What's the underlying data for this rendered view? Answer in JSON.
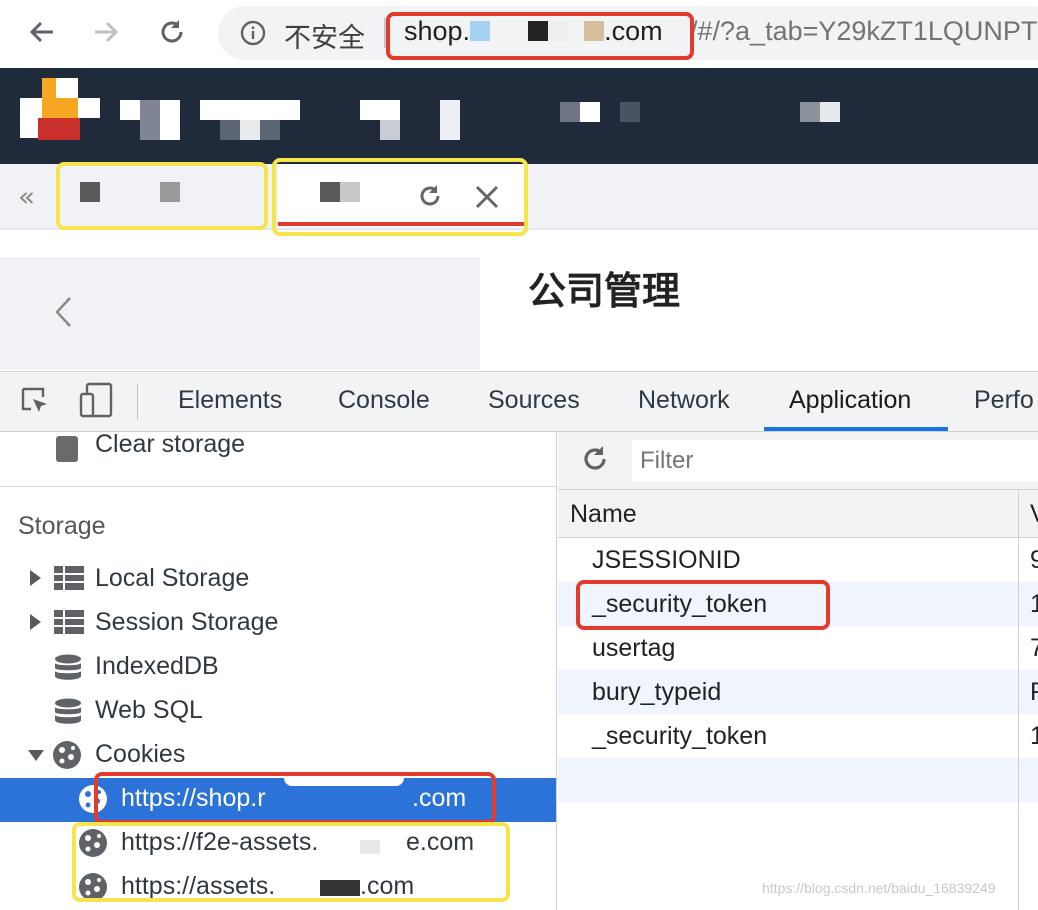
{
  "browser": {
    "insecure_label": "不安全",
    "host_prefix": "shop.",
    "host_suffix": ".com",
    "path": "/#/?a_tab=Y29kZT1LQUNPT"
  },
  "page": {
    "title": "公司管理"
  },
  "devtools": {
    "tabs": [
      "Elements",
      "Console",
      "Sources",
      "Network",
      "Application",
      "Perfo"
    ],
    "active_tab": "Application"
  },
  "sidebar": {
    "clear_storage": "Clear storage",
    "storage_heading": "Storage",
    "items": [
      "Local Storage",
      "Session Storage",
      "IndexedDB",
      "Web SQL",
      "Cookies"
    ],
    "cookie_origins": [
      "https://shop.r",
      "https://f2e-assets.",
      "https://assets."
    ],
    "cookie_origin_suffixes": [
      ".com",
      "e.com",
      ".com"
    ]
  },
  "cookies": {
    "filter_placeholder": "Filter",
    "columns": [
      "Name",
      "V"
    ],
    "rows": [
      {
        "name": "JSESSIONID",
        "value": "9"
      },
      {
        "name": "_security_token",
        "value": "1"
      },
      {
        "name": "usertag",
        "value": "7"
      },
      {
        "name": "bury_typeid",
        "value": "F"
      },
      {
        "name": "_security_token",
        "value": "1"
      }
    ]
  },
  "watermark": "https://blog.csdn.net/baidu_16839249",
  "colors": {
    "annotation_red": "#e23a2c",
    "annotation_yellow": "#f7e34a",
    "selection_blue": "#2c73d9",
    "header_dark": "#1f2a3a"
  }
}
